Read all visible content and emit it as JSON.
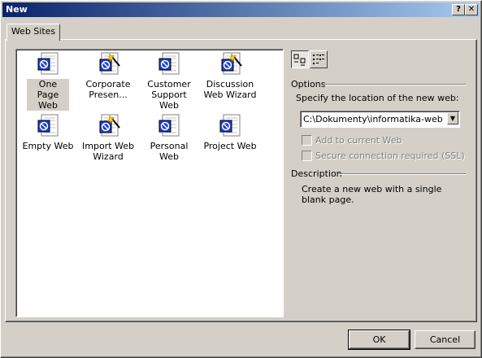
{
  "window": {
    "title": "New",
    "help_btn": "?",
    "close_btn": "✕"
  },
  "tabs": [
    {
      "label": "Web Sites"
    }
  ],
  "templates": [
    {
      "label": "One Page Web",
      "icon": "web-page-icon",
      "selected": true
    },
    {
      "label": "Corporate Presen...",
      "icon": "wizard-icon",
      "selected": false
    },
    {
      "label": "Customer Support Web",
      "icon": "web-page-icon",
      "selected": false
    },
    {
      "label": "Discussion Web Wizard",
      "icon": "wizard-icon",
      "selected": false
    },
    {
      "label": "Empty Web",
      "icon": "web-page-icon",
      "selected": false
    },
    {
      "label": "Import Web Wizard",
      "icon": "wizard-icon",
      "selected": false
    },
    {
      "label": "Personal Web",
      "icon": "web-page-icon",
      "selected": false
    },
    {
      "label": "Project Web",
      "icon": "web-page-icon",
      "selected": false
    }
  ],
  "view_buttons": {
    "large_icons": "large-icons-view-icon",
    "details": "details-view-icon",
    "active": "large_icons"
  },
  "options": {
    "heading": "Options",
    "location_label": "Specify the location of the new web:",
    "location_value": "C:\\Dokumenty\\informatika-web",
    "add_to_current": {
      "label": "Add to current Web",
      "checked": false,
      "enabled": false
    },
    "ssl": {
      "label": "Secure connection required (SSL)",
      "checked": false,
      "enabled": false
    }
  },
  "description": {
    "heading": "Description",
    "text": "Create a new web with a single blank page."
  },
  "buttons": {
    "ok": "OK",
    "cancel": "Cancel"
  },
  "colors": {
    "title_start": "#0a246a",
    "title_end": "#a6caf0",
    "face": "#d4d0c8",
    "icon_blue": "#1c3fd0"
  }
}
